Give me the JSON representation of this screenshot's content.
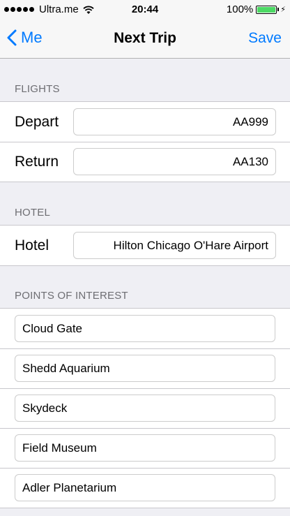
{
  "status_bar": {
    "carrier": "Ultra.me",
    "time": "20:44",
    "battery_percent": "100%",
    "battery_level": 1.0,
    "battery_color": "#4cd964"
  },
  "nav": {
    "back_label": "Me",
    "title": "Next Trip",
    "save_label": "Save",
    "accent_color": "#007aff"
  },
  "flights": {
    "header": "FLIGHTS",
    "depart_label": "Depart",
    "depart_value": "AA999",
    "return_label": "Return",
    "return_value": "AA130"
  },
  "hotel": {
    "header": "HOTEL",
    "label": "Hotel",
    "value": "Hilton Chicago O'Hare Airport"
  },
  "points_of_interest": {
    "header": "POINTS OF INTEREST",
    "items": [
      "Cloud Gate",
      "Shedd Aquarium",
      "Skydeck",
      "Field Museum",
      "Adler Planetarium"
    ]
  }
}
